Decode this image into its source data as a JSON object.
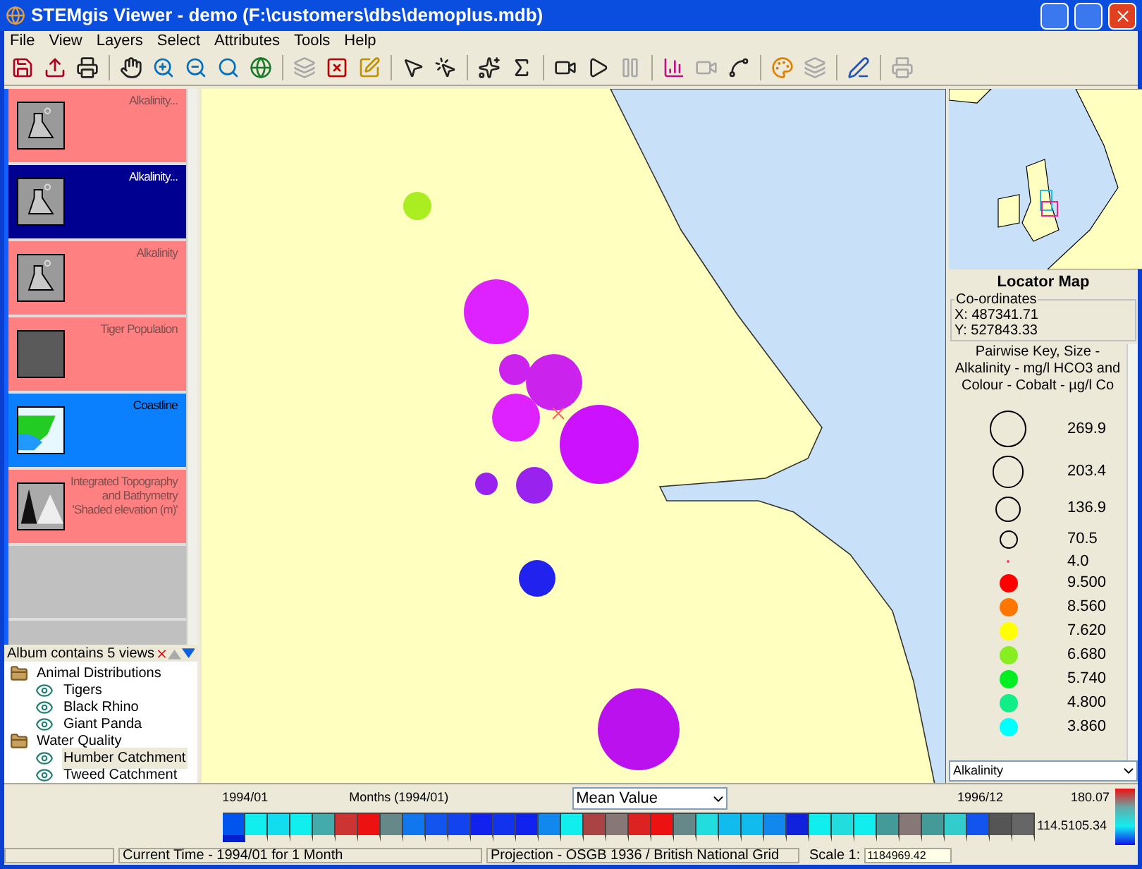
{
  "window": {
    "title": "STEMgis Viewer - demo (F:\\customers\\dbs\\demoplus.mdb)"
  },
  "menu": [
    "File",
    "View",
    "Layers",
    "Select",
    "Attributes",
    "Tools",
    "Help"
  ],
  "toolbar": [
    {
      "kind": "save-down",
      "disabled": false
    },
    {
      "kind": "save-up",
      "disabled": false
    },
    {
      "kind": "print",
      "disabled": false
    },
    {
      "kind": "sep"
    },
    {
      "kind": "hand",
      "disabled": false
    },
    {
      "kind": "zoom-in",
      "disabled": false
    },
    {
      "kind": "zoom-out",
      "disabled": false
    },
    {
      "kind": "zoom-fit",
      "disabled": false
    },
    {
      "kind": "globe",
      "disabled": false
    },
    {
      "kind": "sep"
    },
    {
      "kind": "layers",
      "disabled": true
    },
    {
      "kind": "layer-remove",
      "disabled": false
    },
    {
      "kind": "layer-edit",
      "disabled": false
    },
    {
      "kind": "sep"
    },
    {
      "kind": "select",
      "disabled": false
    },
    {
      "kind": "select-clear",
      "disabled": false
    },
    {
      "kind": "sep"
    },
    {
      "kind": "sparkle",
      "disabled": false
    },
    {
      "kind": "sigma",
      "disabled": false
    },
    {
      "kind": "sep"
    },
    {
      "kind": "camera",
      "disabled": false
    },
    {
      "kind": "play",
      "disabled": false
    },
    {
      "kind": "pause",
      "disabled": true
    },
    {
      "kind": "sep"
    },
    {
      "kind": "bar-chart",
      "disabled": false
    },
    {
      "kind": "camera",
      "disabled": true
    },
    {
      "kind": "scatter",
      "disabled": false
    },
    {
      "kind": "sep"
    },
    {
      "kind": "palette",
      "disabled": false
    },
    {
      "kind": "layers",
      "disabled": true
    },
    {
      "kind": "sep"
    },
    {
      "kind": "pen",
      "disabled": false
    },
    {
      "kind": "sep"
    },
    {
      "kind": "print",
      "disabled": true
    }
  ],
  "layers": [
    {
      "title": "Alkalinity...",
      "kind": "flask",
      "visible": false,
      "selected": false
    },
    {
      "title": "Alkalinity...",
      "kind": "flask",
      "visible": true,
      "selected": true
    },
    {
      "title": "Alkalinity",
      "kind": "flask",
      "visible": false,
      "selected": false
    },
    {
      "title": "Tiger Population",
      "kind": "photo",
      "visible": false,
      "selected": false
    },
    {
      "title": "Coastline",
      "kind": "coast",
      "visible": true,
      "selected": false
    },
    {
      "title": "Integrated Topography and Bathymetry 'Shaded elevation (m)'",
      "kind": "mountain",
      "visible": false,
      "selected": false
    }
  ],
  "album": {
    "caption": "Album contains 5 views",
    "groups": [
      {
        "name": "Animal Distributions",
        "children": [
          {
            "name": "Tigers",
            "selected": false
          },
          {
            "name": "Black Rhino",
            "selected": false
          },
          {
            "name": "Giant Panda",
            "selected": false
          }
        ]
      },
      {
        "name": "Water Quality",
        "children": [
          {
            "name": "Humber Catchment",
            "selected": true
          },
          {
            "name": "Tweed Catchment",
            "selected": false
          }
        ]
      }
    ]
  },
  "locator": {
    "title": "Locator Map"
  },
  "coordinates": {
    "label": "Co-ordinates",
    "x": "X: 487341.71",
    "y": "Y: 527843.33"
  },
  "key": {
    "title": "Pairwise Key, Size - Alkalinity - mg/l HCO3 and Colour - Cobalt - µg/l Co",
    "items": [
      {
        "kind": "size",
        "label": "269.9"
      },
      {
        "kind": "size",
        "label": "203.4"
      },
      {
        "kind": "size",
        "label": "136.9"
      },
      {
        "kind": "size",
        "label": "70.5"
      },
      {
        "kind": "size",
        "label": "4.0"
      },
      {
        "kind": "colour",
        "color": "#ff0000",
        "label": "9.500"
      },
      {
        "kind": "colour",
        "color": "#ff7700",
        "label": "8.560"
      },
      {
        "kind": "colour",
        "color": "#ffff00",
        "label": "7.620"
      },
      {
        "kind": "colour",
        "color": "#88ee22",
        "label": "6.680"
      },
      {
        "kind": "colour",
        "color": "#00ee22",
        "label": "5.740"
      },
      {
        "kind": "colour",
        "color": "#11ee88",
        "label": "4.800"
      },
      {
        "kind": "colour",
        "color": "#00ffff",
        "label": "3.860"
      }
    ],
    "field": "Alkalinity"
  },
  "timeline": {
    "start": "1994/01",
    "period": "Months (1994/01)",
    "statistic": "Mean Value",
    "end": "1996/12",
    "max": "180.07",
    "current": "114.5",
    "min": "105.34",
    "cells": [
      {
        "color": "#0055ee",
        "selected": true
      },
      {
        "color": "#11eeee",
        "selected": false
      },
      {
        "color": "#11ddee",
        "selected": false
      },
      {
        "color": "#11eeee",
        "selected": false
      },
      {
        "color": "#44aaaa",
        "selected": false
      },
      {
        "color": "#cc3333",
        "selected": false
      },
      {
        "color": "#ee1111",
        "selected": false
      },
      {
        "color": "#668888",
        "selected": false
      },
      {
        "color": "#1177ee",
        "selected": false
      },
      {
        "color": "#1155ee",
        "selected": false
      },
      {
        "color": "#1144ee",
        "selected": false
      },
      {
        "color": "#1122ee",
        "selected": false
      },
      {
        "color": "#1133ee",
        "selected": false
      },
      {
        "color": "#1122ee",
        "selected": false
      },
      {
        "color": "#1188ee",
        "selected": false
      },
      {
        "color": "#11eeee",
        "selected": false
      },
      {
        "color": "#aa4444",
        "selected": false
      },
      {
        "color": "#887777",
        "selected": false
      },
      {
        "color": "#dd2222",
        "selected": false
      },
      {
        "color": "#ee1111",
        "selected": false
      },
      {
        "color": "#668888",
        "selected": false
      },
      {
        "color": "#22dddd",
        "selected": false
      },
      {
        "color": "#11bbee",
        "selected": false
      },
      {
        "color": "#11bbee",
        "selected": false
      },
      {
        "color": "#1188ee",
        "selected": false
      },
      {
        "color": "#1122dd",
        "selected": false
      },
      {
        "color": "#11eeee",
        "selected": false
      },
      {
        "color": "#22dddd",
        "selected": false
      },
      {
        "color": "#11eeee",
        "selected": false
      },
      {
        "color": "#449999",
        "selected": false
      },
      {
        "color": "#887777",
        "selected": false
      },
      {
        "color": "#449999",
        "selected": false
      },
      {
        "color": "#33cccc",
        "selected": false
      },
      {
        "color": "#1155ee",
        "selected": false
      },
      {
        "color": "#555555",
        "selected": false
      },
      {
        "color": "#666666",
        "selected": false
      }
    ]
  },
  "status_bar": {
    "time": "Current Time - 1994/01 for 1 Month",
    "projection": "Projection - OSGB 1936 / British National Grid",
    "scale_label": "Scale 1:",
    "scale": "1184969.42"
  }
}
